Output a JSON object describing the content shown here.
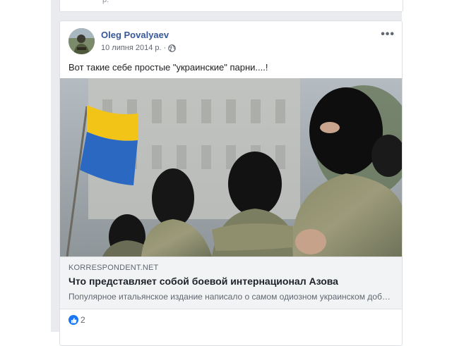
{
  "previous_post": {
    "truncated_text": "р."
  },
  "post": {
    "author": "Oleg Povalyaev",
    "date": "10 липня 2014 р.",
    "date_separator": "·",
    "privacy_icon": "globe-icon",
    "more_icon": "more-options-icon",
    "more_label": "•••",
    "text": "Вот такие себе простые \"украинские\" парни....!",
    "link": {
      "domain": "KORRESPONDENT.NET",
      "title": "Что представляет собой боевой интернационал Азова",
      "description": "Популярное итальянское издание написало о самом одиозном украинском добровольческом батальоне"
    },
    "reactions": {
      "icon": "like-icon",
      "count": "2"
    }
  },
  "colors": {
    "author_link": "#385898",
    "feed_background": "#e9ebee",
    "like_blue": "#1877f2",
    "flag_blue": "#2b68c2",
    "flag_yellow": "#f2c418"
  }
}
